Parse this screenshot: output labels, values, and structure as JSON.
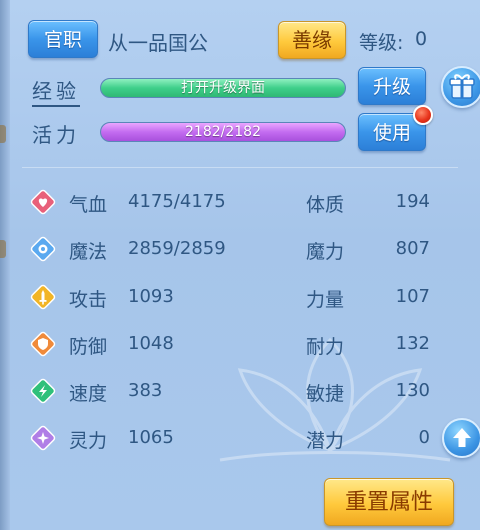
{
  "header": {
    "title_button": "官职",
    "title_text": "从一品国公",
    "shan_button": "善缘",
    "level_label": "等级:",
    "level_value": "0"
  },
  "experience": {
    "label": "经验",
    "bar_text": "打开升级界面",
    "fill_percent": 100,
    "button": "升级"
  },
  "vitality": {
    "label": "活力",
    "bar_text": "2182/2182",
    "fill_percent": 100,
    "button": "使用"
  },
  "stats": [
    {
      "icon": "heart-icon",
      "name": "气血",
      "value": "4175/4175",
      "attr_name": "体质",
      "attr_value": "194",
      "color": "#e8607a"
    },
    {
      "icon": "mana-icon",
      "name": "魔法",
      "value": "2859/2859",
      "attr_name": "魔力",
      "attr_value": "807",
      "color": "#5aa9f0"
    },
    {
      "icon": "sword-icon",
      "name": "攻击",
      "value": "1093",
      "attr_name": "力量",
      "attr_value": "107",
      "color": "#f2b526"
    },
    {
      "icon": "shield-icon",
      "name": "防御",
      "value": "1048",
      "attr_name": "耐力",
      "attr_value": "132",
      "color": "#f08a3a"
    },
    {
      "icon": "speed-icon",
      "name": "速度",
      "value": "383",
      "attr_name": "敏捷",
      "attr_value": "130",
      "color": "#2fc07a"
    },
    {
      "icon": "spirit-icon",
      "name": "灵力",
      "value": "1065",
      "attr_name": "潜力",
      "attr_value": "0",
      "color": "#b07ee6"
    }
  ],
  "footer": {
    "reset_button": "重置属性"
  },
  "colors": {
    "text": "#2f5783",
    "blue_button": "#3a95ea",
    "gold_button": "#ffc93c",
    "exp_bar": "#3fcf8a",
    "vit_bar": "#c36cf0"
  }
}
